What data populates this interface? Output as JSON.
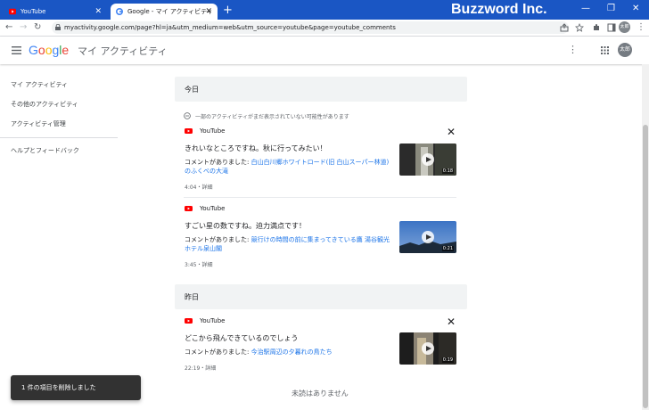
{
  "browser": {
    "tabs": [
      {
        "label": "YouTube",
        "close": "✕"
      },
      {
        "label": "Google - マイ アクティビティ",
        "close": "✕"
      }
    ],
    "new_tab": "+",
    "brand_text": "Buzzword Inc.",
    "window_controls": {
      "min": "—",
      "max": "❐",
      "close": "✕"
    },
    "url": "myactivity.google.com/page?hl=ja&utm_medium=web&utm_source=youtube&page=youtube_comments",
    "profile_initials": "太郎"
  },
  "header": {
    "google_letters": [
      {
        "ch": "G",
        "color": "#4285F4"
      },
      {
        "ch": "o",
        "color": "#EA4335"
      },
      {
        "ch": "o",
        "color": "#FBBC05"
      },
      {
        "ch": "g",
        "color": "#4285F4"
      },
      {
        "ch": "l",
        "color": "#34A853"
      },
      {
        "ch": "e",
        "color": "#EA4335"
      }
    ],
    "title": "マイ アクティビティ",
    "avatar": "太郎"
  },
  "sidebar": {
    "items": [
      {
        "label": "マイ アクティビティ"
      },
      {
        "label": "その他のアクティビティ"
      },
      {
        "label": "アクティビティ管理"
      },
      {
        "label": "ヘルプとフィードバック"
      }
    ]
  },
  "main": {
    "today_label": "今日",
    "notice": "一部のアクティビティがまだ表示されていない可能性があります",
    "yesterday_label": "昨日",
    "end_text": "未読はありません",
    "comment_prefix": "コメントがありました: ",
    "cards": [
      {
        "source": "YouTube",
        "title": "きれいなところですね。秋に行ってみたい！",
        "link": "白山白川郷ホワイトロード(旧 白山スーパー林道)のふくべの大滝",
        "meta": "4:04・詳細",
        "duration": "0:18"
      },
      {
        "source": "YouTube",
        "title": "すごい星の数ですね。迫力満点です！",
        "link": "競行けの時間の前に集まってきている鷹 湯谷観光ホテル泉山閣",
        "meta": "3:45・詳細",
        "duration": "0:21"
      },
      {
        "source": "YouTube",
        "title": "どこから飛んできているのでしょう",
        "link": "今治駅周辺の夕暮れの鳥たち",
        "meta": "22:19・詳細",
        "duration": "0:19"
      }
    ]
  },
  "snackbar": {
    "text": "1 件の項目を削除しました"
  },
  "colors": {
    "tabbar": "#1a56c4",
    "link": "#1a73e8",
    "youtube_red": "#ff0000"
  }
}
